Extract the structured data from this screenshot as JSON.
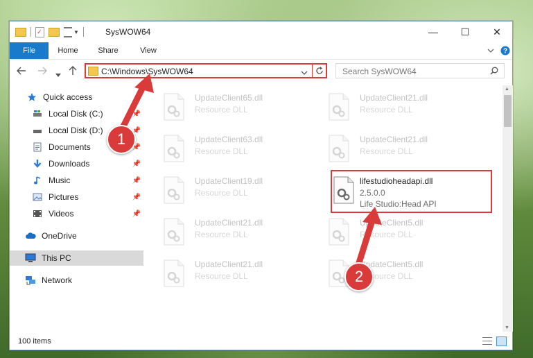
{
  "window": {
    "title": "SysWOW64",
    "controls": {
      "minimize": "—",
      "maximize": "☐",
      "close": "✕"
    }
  },
  "ribbon": {
    "tabs": [
      "File",
      "Home",
      "Share",
      "View"
    ]
  },
  "address": {
    "path": "C:\\Windows\\SysWOW64",
    "search_placeholder": "Search SysWOW64"
  },
  "sidebar": {
    "items": [
      {
        "label": "Quick access",
        "icon": "star-icon"
      },
      {
        "label": "Local Disk (C:)",
        "icon": "drive-icon"
      },
      {
        "label": "Local Disk (D:)",
        "icon": "drive-icon"
      },
      {
        "label": "Documents",
        "icon": "documents-icon"
      },
      {
        "label": "Downloads",
        "icon": "download-icon"
      },
      {
        "label": "Music",
        "icon": "music-icon"
      },
      {
        "label": "Pictures",
        "icon": "pictures-icon"
      },
      {
        "label": "Videos",
        "icon": "videos-icon"
      },
      {
        "label": "OneDrive",
        "icon": "cloud-icon"
      },
      {
        "label": "This PC",
        "icon": "computer-icon"
      },
      {
        "label": "Network",
        "icon": "network-icon"
      }
    ]
  },
  "files": {
    "left": [
      {
        "name": "UpdateClient65.dll",
        "sub": "Resource DLL"
      },
      {
        "name": "UpdateClient63.dll",
        "sub": "Resource DLL"
      },
      {
        "name": "UpdateClient19.dll",
        "sub": "Resource DLL"
      },
      {
        "name": "UpdateClient21.dll",
        "sub": "Resource DLL"
      },
      {
        "name": "UpdateClient21.dll",
        "sub": "Resource DLL"
      }
    ],
    "right": [
      {
        "name": "UpdateClient21.dll",
        "sub": "Resource DLL"
      },
      {
        "name": "UpdateClient21.dll",
        "sub": "Resource DLL"
      },
      {
        "name": "UpdateClient5.dll",
        "sub": "Resource DLL"
      },
      {
        "name": "UpdateClient5.dll",
        "sub": "Resource DLL"
      }
    ],
    "highlighted": {
      "name": "lifestudioheadapi.dll",
      "version": "2.5.0.0",
      "description": "Life Studio:Head API"
    }
  },
  "status": {
    "count": "100 items"
  },
  "callouts": [
    "1",
    "2"
  ],
  "colors": {
    "accent": "#1979ca",
    "highlight": "#d93a3a"
  }
}
